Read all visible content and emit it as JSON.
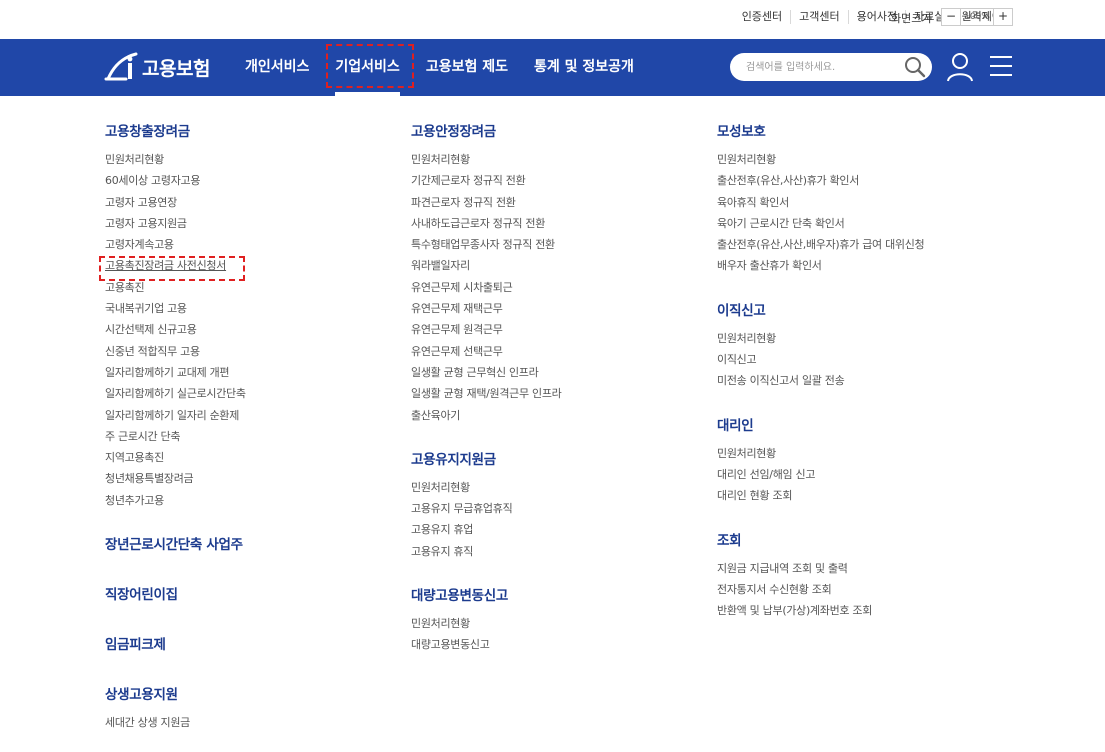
{
  "utility_bar": {
    "links": [
      "인증센터",
      "고객센터",
      "용어사전",
      "자료실",
      "원격제어"
    ],
    "screen_size_label": "화면크기",
    "zoom_minus": "−",
    "zoom_value": "100%",
    "zoom_plus": "+"
  },
  "header": {
    "logo_text": "고용보험",
    "nav": [
      "개인서비스",
      "기업서비스",
      "고용보험 제도",
      "통계 및 정보공개"
    ],
    "active_nav": "기업서비스",
    "search_placeholder": "검색어를 입력하세요.",
    "bg_color": "#2047a8"
  },
  "columns": [
    {
      "sections": [
        {
          "title": "고용창출장려금",
          "items": [
            "민원처리현황",
            "60세이상 고령자고용",
            "고령자 고용연장",
            "고령자 고용지원금",
            "고령자계속고용",
            "고용촉진장려금 사전신청서",
            "고용촉진",
            "국내복귀기업 고용",
            "시간선택제 신규고용",
            "신중년 적합직무 고용",
            "일자리함께하기 교대제 개편",
            "일자리함께하기 실근로시간단축",
            "일자리함께하기 일자리 순환제",
            "주 근로시간 단축",
            "지역고용촉진",
            "청년채용특별장려금",
            "청년추가고용"
          ]
        },
        {
          "title": "장년근로시간단축 사업주",
          "items": []
        },
        {
          "title": "직장어린이집",
          "items": []
        },
        {
          "title": "임금피크제",
          "items": []
        },
        {
          "title": "상생고용지원",
          "items": [
            "세대간 상생 지원금"
          ]
        }
      ]
    },
    {
      "sections": [
        {
          "title": "고용안정장려금",
          "items": [
            "민원처리현황",
            "기간제근로자 정규직 전환",
            "파견근로자 정규직 전환",
            "사내하도급근로자 정규직 전환",
            "특수형태업무종사자 정규직 전환",
            "워라밸일자리",
            "유연근무제 시차출퇴근",
            "유연근무제 재택근무",
            "유연근무제 원격근무",
            "유연근무제 선택근무",
            "일생활 균형 근무혁신 인프라",
            "일생활 균형 재택/원격근무 인프라",
            "출산육아기"
          ]
        },
        {
          "title": "고용유지지원금",
          "items": [
            "민원처리현황",
            "고용유지 무급휴업휴직",
            "고용유지 휴업",
            "고용유지 휴직"
          ]
        },
        {
          "title": "대량고용변동신고",
          "items": [
            "민원처리현황",
            "대량고용변동신고"
          ]
        }
      ]
    },
    {
      "sections": [
        {
          "title": "모성보호",
          "items": [
            "민원처리현황",
            "출산전후(유산,사산)휴가 확인서",
            "육아휴직 확인서",
            "육아기 근로시간 단축 확인서",
            "출산전후(유산,사산,배우자)휴가 급여 대위신청",
            "배우자 출산휴가 확인서"
          ]
        },
        {
          "title": "이직신고",
          "items": [
            "민원처리현황",
            "이직신고",
            "미전송 이직신고서 일괄 전송"
          ]
        },
        {
          "title": "대리인",
          "items": [
            "민원처리현황",
            "대리인 선임/해임 신고",
            "대리인 현황 조회"
          ]
        },
        {
          "title": "조회",
          "items": [
            "지원금 지급내역 조회 및 출력",
            "전자통지서 수신현황 조회",
            "반환액 및 납부(가상)계좌번호 조회"
          ]
        }
      ]
    }
  ]
}
